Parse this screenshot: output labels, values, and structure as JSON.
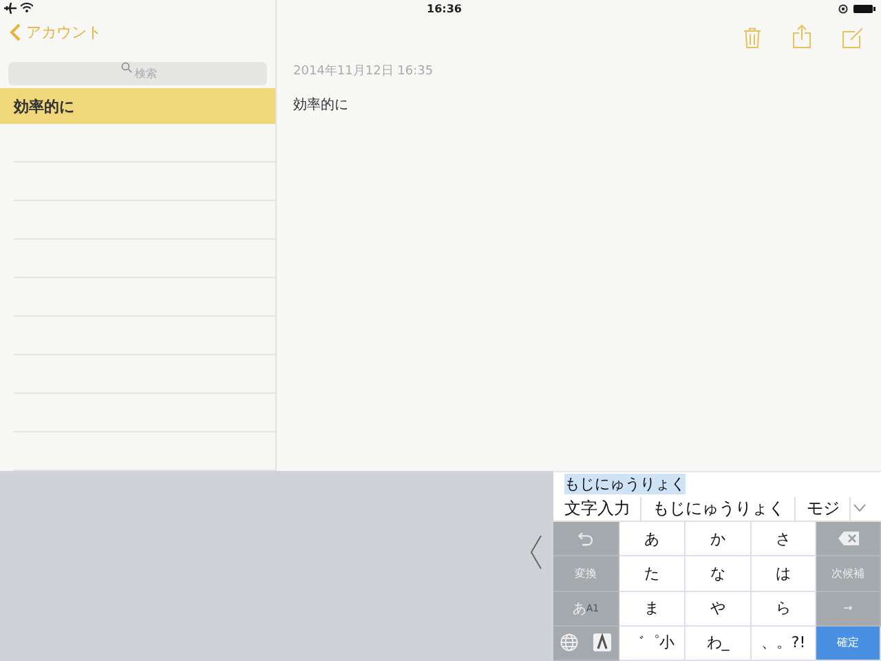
{
  "status_bar": {
    "time": "16:36"
  },
  "sidebar": {
    "back": "アカウント",
    "search": {
      "placeholder": "検索"
    },
    "notes": [
      {
        "title": "効率的に",
        "selected": true
      }
    ]
  },
  "note": {
    "date": "2014年11月12日 16:35",
    "body": "効率的に"
  },
  "keyboard": {
    "composing": "もじにゅうりょく",
    "candidates": [
      "文字入力",
      "もじにゅうりょく",
      "モジ"
    ],
    "rows": [
      [
        {
          "kind": "undo"
        },
        {
          "kind": "char",
          "label": "あ"
        },
        {
          "kind": "char",
          "label": "か"
        },
        {
          "kind": "char",
          "label": "さ"
        },
        {
          "kind": "delete"
        }
      ],
      [
        {
          "kind": "function",
          "label": "変換"
        },
        {
          "kind": "char",
          "label": "た"
        },
        {
          "kind": "char",
          "label": "な"
        },
        {
          "kind": "char",
          "label": "は"
        },
        {
          "kind": "function",
          "label": "次候補"
        }
      ],
      [
        {
          "kind": "mode",
          "label": "あ",
          "sub": "A1"
        },
        {
          "kind": "char",
          "label": "ま"
        },
        {
          "kind": "char",
          "label": "や"
        },
        {
          "kind": "char",
          "label": "ら"
        },
        {
          "kind": "function",
          "label": "→"
        }
      ],
      [
        {
          "kind": "globe"
        },
        {
          "kind": "char",
          "label": "゛゜小"
        },
        {
          "kind": "char",
          "label": "わ_"
        },
        {
          "kind": "char",
          "label": "、。?!"
        },
        {
          "kind": "confirm",
          "label": "確定"
        }
      ]
    ]
  }
}
